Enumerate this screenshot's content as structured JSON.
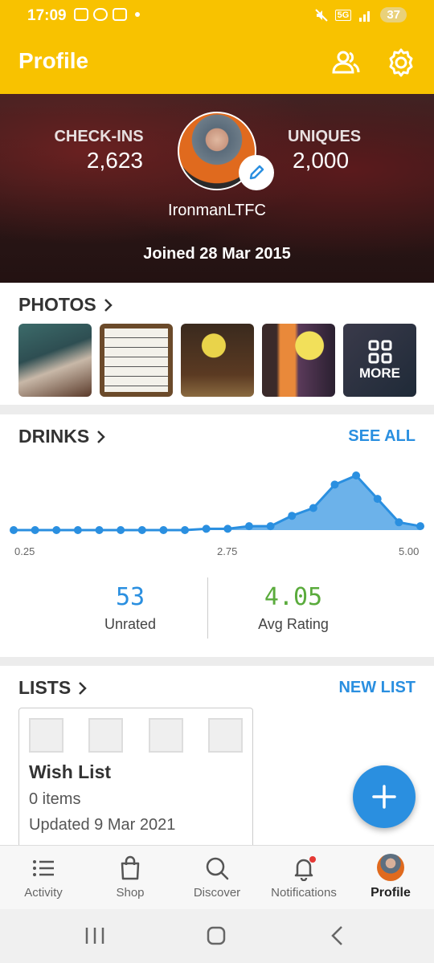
{
  "status_bar": {
    "time": "17:09",
    "network": "5G",
    "battery": "37"
  },
  "app_bar": {
    "title": "Profile",
    "icons": [
      "friends-icon",
      "settings-icon"
    ]
  },
  "profile": {
    "checkins_label": "CHECK-INS",
    "checkins_value": "2,623",
    "uniques_label": "UNIQUES",
    "uniques_value": "2,000",
    "username": "IronmanLTFC",
    "joined": "Joined 28 Mar 2015"
  },
  "photos": {
    "title": "PHOTOS",
    "more_label": "MORE"
  },
  "drinks": {
    "title": "DRINKS",
    "see_all": "SEE ALL",
    "unrated_value": "53",
    "unrated_label": "Unrated",
    "avg_value": "4.05",
    "avg_label": "Avg Rating",
    "accent_color": "#2a8fe0",
    "avg_color": "#5aab3c"
  },
  "chart_data": {
    "type": "area",
    "x": [
      0.25,
      0.5,
      0.75,
      1.0,
      1.25,
      1.5,
      1.75,
      2.0,
      2.25,
      2.5,
      2.75,
      3.0,
      3.25,
      3.5,
      3.75,
      4.0,
      4.25,
      4.5,
      4.75,
      5.0
    ],
    "values": [
      0,
      0,
      0,
      0,
      0,
      0,
      0,
      0,
      0,
      1,
      1,
      3,
      3,
      11,
      17,
      35,
      42,
      24,
      6,
      3
    ],
    "x_tick_labels": [
      "0.25",
      "2.75",
      "5.00"
    ],
    "color": "#2a8fe0"
  },
  "lists": {
    "title": "LISTS",
    "new_list": "NEW LIST",
    "items": [
      {
        "name": "Wish List",
        "count": "0 items",
        "updated": "Updated 9 Mar 2021"
      }
    ]
  },
  "bottom_nav": {
    "items": [
      {
        "label": "Activity"
      },
      {
        "label": "Shop"
      },
      {
        "label": "Discover"
      },
      {
        "label": "Notifications"
      },
      {
        "label": "Profile"
      }
    ]
  }
}
